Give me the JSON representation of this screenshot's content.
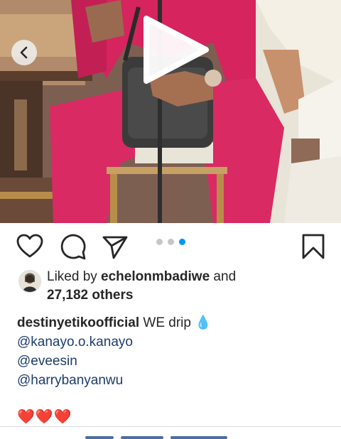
{
  "post": {
    "media": {
      "play_icon": "play-icon",
      "prev_icon": "chevron-left-icon",
      "dominant_colors": [
        "#d6245e",
        "#8a6a5a",
        "#f2eee4",
        "#3b3b3b"
      ]
    },
    "actions": {
      "like_icon": "heart-icon",
      "comment_icon": "comment-icon",
      "share_icon": "send-icon",
      "save_icon": "bookmark-icon"
    },
    "carousel": {
      "total": 3,
      "active_index": 2,
      "active_color": "#0095f6",
      "inactive_color": "#c7c7c7"
    },
    "likes": {
      "prefix": "Liked by ",
      "user": "echelonmbadiwe",
      "connector": " and",
      "others": "27,182 others"
    },
    "caption": {
      "author": "destinyetikoofficial",
      "text": " WE drip 💧",
      "mentions": [
        "@kanayo.o.kanayo",
        "@eveesin",
        "@harrybanyanwu"
      ],
      "hearts": "❤️❤️❤️"
    }
  }
}
